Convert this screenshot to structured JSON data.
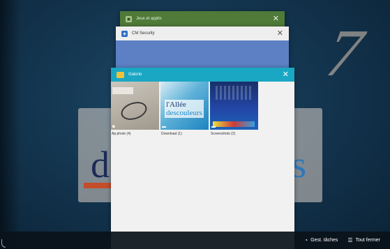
{
  "cards": {
    "jeux": {
      "title": "Jeux et applis",
      "close": "✕",
      "icon": "games-app-icon"
    },
    "cm": {
      "title": "CM Security",
      "close": "✕",
      "icon": "cm-security-app-icon"
    },
    "galerie": {
      "title": "Galerie",
      "close": "✕",
      "icon": "gallery-app-icon",
      "albums": [
        {
          "label": "Ap.photo (4)",
          "badge": "camera-icon"
        },
        {
          "label": "Download (1)",
          "badge": "folder-icon",
          "thumb_text_a": "l'Allée",
          "thumb_text_b": "descouleurs"
        },
        {
          "label": "Screenshots (2)",
          "badge": "folder-icon"
        }
      ]
    }
  },
  "bottom_bar": {
    "task_manager": "Gest. tâches",
    "close_all": "Tout fermer"
  },
  "colors": {
    "galerie_header": "#1aa7c4",
    "cm_header": "#eeeeee",
    "jeux_header": "#4f7a38",
    "background": "#143650"
  }
}
